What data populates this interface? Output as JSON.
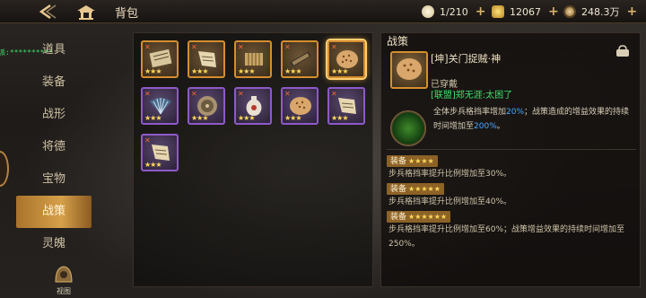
{
  "topbar": {
    "title": "背包",
    "resources": [
      {
        "icon": "rice-bowl-icon",
        "value": "1/210"
      },
      {
        "icon": "gold-ingot-icon",
        "value": "12067"
      },
      {
        "icon": "copper-coin-icon",
        "value": "248.3万"
      }
    ]
  },
  "overlay": {
    "text": "派:**********"
  },
  "nav": {
    "items": [
      "道具",
      "装备",
      "战形",
      "将德",
      "宝物",
      "战策",
      "灵魄"
    ],
    "active_index": 5,
    "bottom_label": "视图"
  },
  "grid": {
    "items": [
      {
        "name": "scroll-book-icon",
        "quality": "orange",
        "stars": "★★★"
      },
      {
        "name": "scroll-icon",
        "quality": "orange",
        "stars": "★★★"
      },
      {
        "name": "bamboo-scroll-icon",
        "quality": "orange",
        "stars": "★★★"
      },
      {
        "name": "bamboo-slips-icon",
        "quality": "orange",
        "stars": "★★★"
      },
      {
        "name": "turtle-shell-icon",
        "quality": "orange",
        "stars": "★★★"
      },
      {
        "name": "feather-fan-icon",
        "quality": "purple",
        "stars": "★★★"
      },
      {
        "name": "bronze-mirror-icon",
        "quality": "purple",
        "stars": "★★★"
      },
      {
        "name": "porcelain-vase-icon",
        "quality": "purple",
        "stars": "★★★"
      },
      {
        "name": "turtle-shell-icon",
        "quality": "purple",
        "stars": "★★★"
      },
      {
        "name": "scroll-icon",
        "quality": "purple",
        "stars": "★★★"
      },
      {
        "name": "scroll-icon",
        "quality": "purple",
        "stars": "★★★"
      }
    ]
  },
  "detail": {
    "header": "战策",
    "name": "[坤]关门捉贼·神",
    "state": "已穿戴",
    "chat": "[联盟]郑无涯:太困了",
    "effect_parts": [
      "全体步兵格挡率增加",
      "20%",
      "；战策造成的增益效果的持续时间增加至",
      "200%",
      "。"
    ],
    "tiers": [
      {
        "title": "装备",
        "stars": "★★★★",
        "text": "步兵格挡率提升比例增加至30%。"
      },
      {
        "title": "装备",
        "stars": "★★★★★",
        "text": "步兵格挡率提升比例增加至40%。"
      },
      {
        "title": "装备",
        "stars": "★★★★★★",
        "text": "步兵格挡率提升比例增加至60%；战策增益效果的持续时间增加至250%。"
      }
    ]
  }
}
